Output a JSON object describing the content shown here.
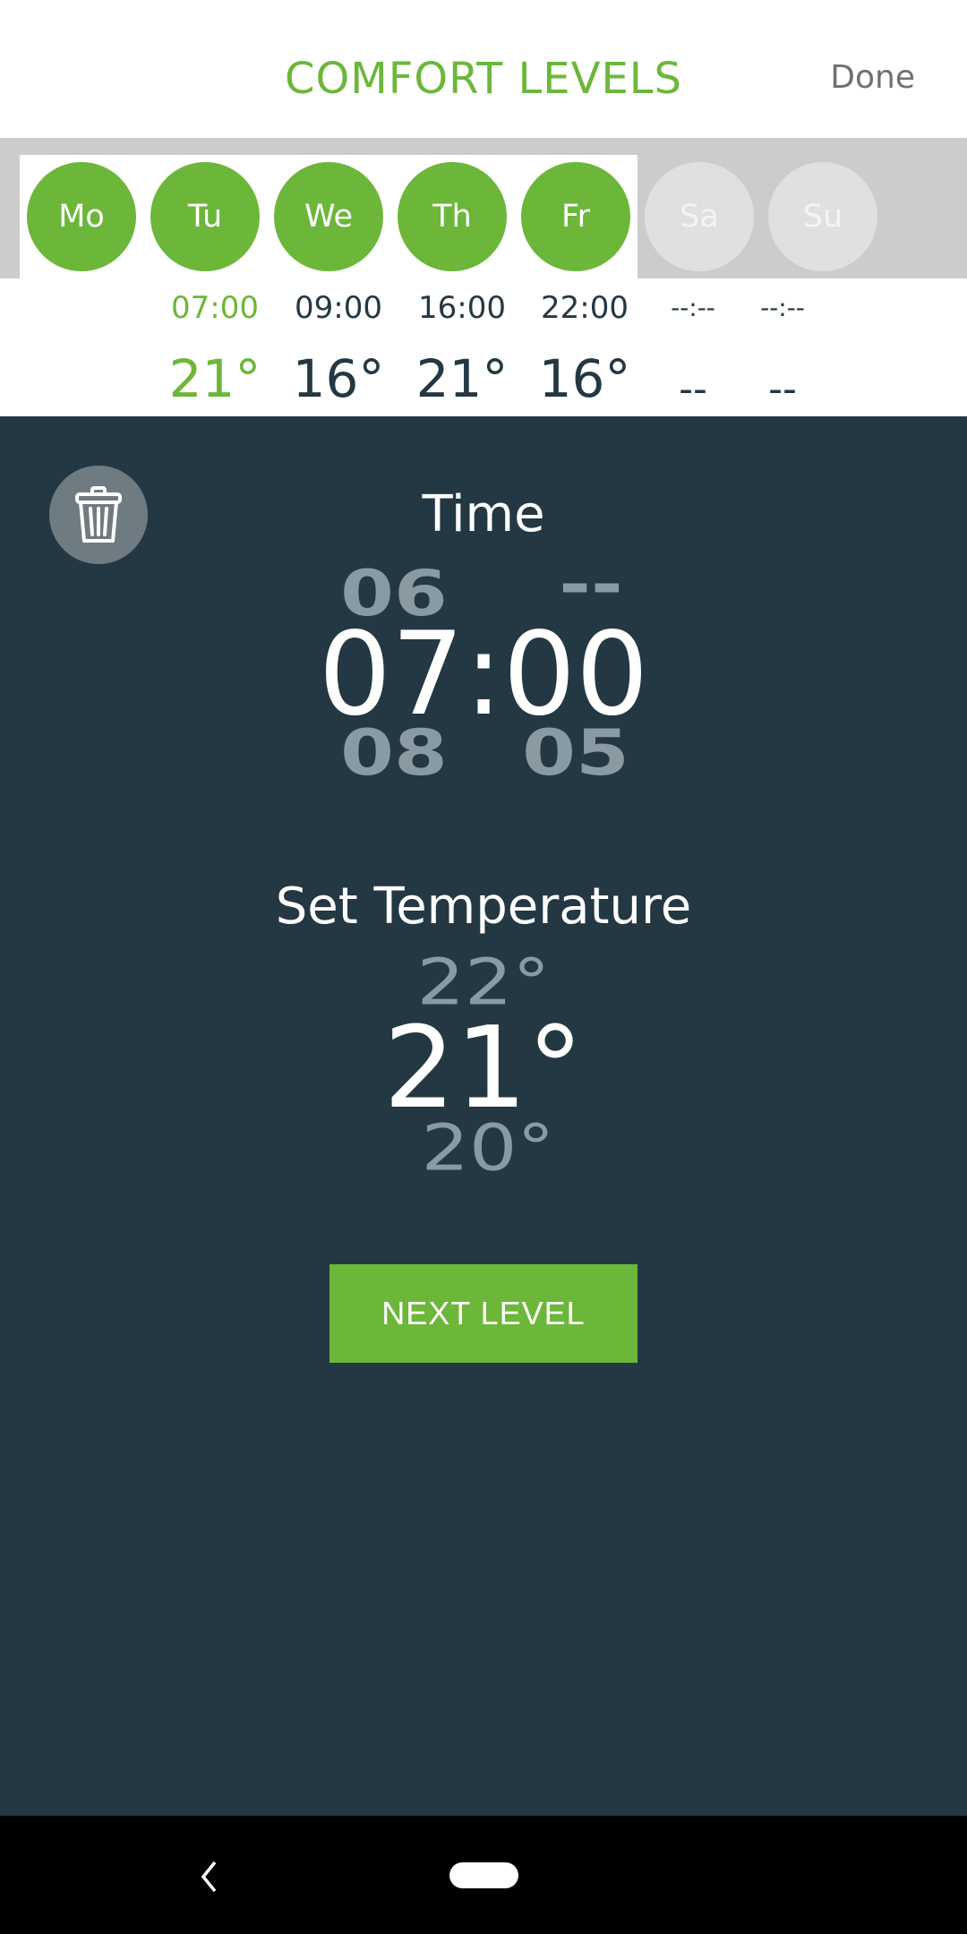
{
  "header": {
    "title": "COMFORT LEVELS",
    "done_label": "Done"
  },
  "colors": {
    "accent": "#6cb73a",
    "dark_bg": "#233843",
    "text_dark": "#243843",
    "inactive_day": "#e0e0e0",
    "band": "#cccccc"
  },
  "days": [
    {
      "label": "Mo",
      "selected": true
    },
    {
      "label": "Tu",
      "selected": true
    },
    {
      "label": "We",
      "selected": true
    },
    {
      "label": "Th",
      "selected": true
    },
    {
      "label": "Fr",
      "selected": true
    },
    {
      "label": "Sa",
      "selected": false
    },
    {
      "label": "Su",
      "selected": false
    }
  ],
  "levels": [
    {
      "time": "07:00",
      "temp": "21°",
      "active": true
    },
    {
      "time": "09:00",
      "temp": "16°",
      "active": false
    },
    {
      "time": "16:00",
      "temp": "21°",
      "active": false
    },
    {
      "time": "22:00",
      "temp": "16°",
      "active": false
    },
    {
      "time": "--:--",
      "temp": "--",
      "active": false
    },
    {
      "time": "--:--",
      "temp": "--",
      "active": false
    }
  ],
  "editor": {
    "delete_icon": "trash-icon",
    "time_label": "Time",
    "time_picker": {
      "hour_prev": "06",
      "minute_prev": "--",
      "current": "07:00",
      "hour_next": "08",
      "minute_next": "05"
    },
    "temp_label": "Set Temperature",
    "temp_picker": {
      "prev": "22°",
      "current": "21°",
      "next": "20°"
    },
    "next_button": "NEXT LEVEL"
  },
  "navbar": {
    "back_icon": "back-chevron-icon",
    "home_icon": "home-pill-icon"
  }
}
